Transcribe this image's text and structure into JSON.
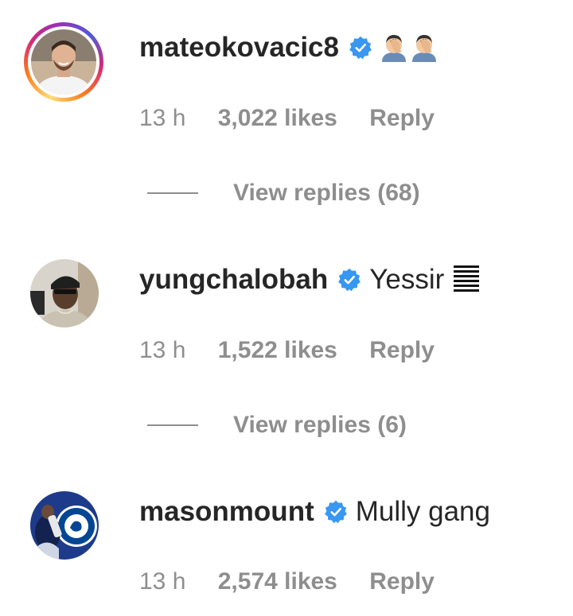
{
  "comments": [
    {
      "username": "mateokovacic8",
      "verified": true,
      "text": "",
      "emoji": [
        "man-facepalming-emoji",
        "man-facepalming-emoji"
      ],
      "time": "13 h",
      "likes": "3,022 likes",
      "reply": "Reply",
      "view_replies": "View replies (68)",
      "has_story": true
    },
    {
      "username": "yungchalobah",
      "verified": true,
      "text": "Yessir",
      "emoji": [
        "horizontal-bars-icon"
      ],
      "time": "13 h",
      "likes": "1,522 likes",
      "reply": "Reply",
      "view_replies": "View replies (6)",
      "has_story": false
    },
    {
      "username": "masonmount",
      "verified": true,
      "text": "Mully gang",
      "emoji": [],
      "time": "13 h",
      "likes": "2,574 likes",
      "reply": "Reply",
      "has_story": false
    }
  ],
  "colors": {
    "verified_blue": "#3897f0",
    "meta_gray": "#8e8e8e",
    "text_dark": "#262626",
    "chelsea_blue": "#034694"
  }
}
